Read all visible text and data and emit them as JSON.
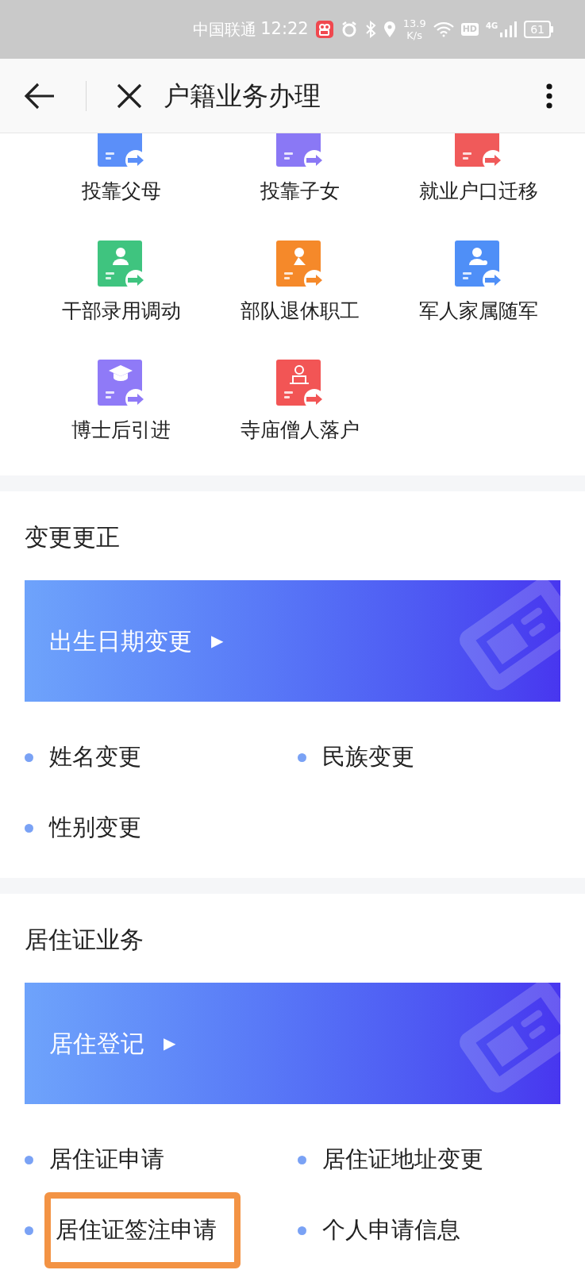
{
  "status_bar": {
    "carrier": "中国联通",
    "time": "12:22",
    "speed": "13.9",
    "speed_unit": "K/s",
    "hd": "HD",
    "network": "4G",
    "battery": "61"
  },
  "header": {
    "title": "户籍业务办理"
  },
  "services": [
    {
      "label": "投靠父母",
      "color": "#5b8ff9"
    },
    {
      "label": "投靠子女",
      "color": "#8a78f5"
    },
    {
      "label": "就业户口迁移",
      "color": "#f05a5a"
    },
    {
      "label": "干部录用调动",
      "color": "#3fc47f"
    },
    {
      "label": "部队退休职工",
      "color": "#f5892a"
    },
    {
      "label": "军人家属随军",
      "color": "#4f8ff7"
    },
    {
      "label": "博士后引进",
      "color": "#8f7af7"
    },
    {
      "label": "寺庙僧人落户",
      "color": "#f25555"
    }
  ],
  "sections": [
    {
      "title": "变更更正",
      "banner": {
        "label": "出生日期变更",
        "arrow": "▶"
      },
      "links": [
        {
          "label": "姓名变更",
          "highlighted": false
        },
        {
          "label": "民族变更",
          "highlighted": false
        },
        {
          "label": "性别变更",
          "highlighted": false
        }
      ]
    },
    {
      "title": "居住证业务",
      "banner": {
        "label": "居住登记",
        "arrow": "▶"
      },
      "links": [
        {
          "label": "居住证申请",
          "highlighted": false
        },
        {
          "label": "居住证地址变更",
          "highlighted": false
        },
        {
          "label": "居住证签注申请",
          "highlighted": true
        },
        {
          "label": "个人申请信息",
          "highlighted": false
        }
      ]
    }
  ]
}
